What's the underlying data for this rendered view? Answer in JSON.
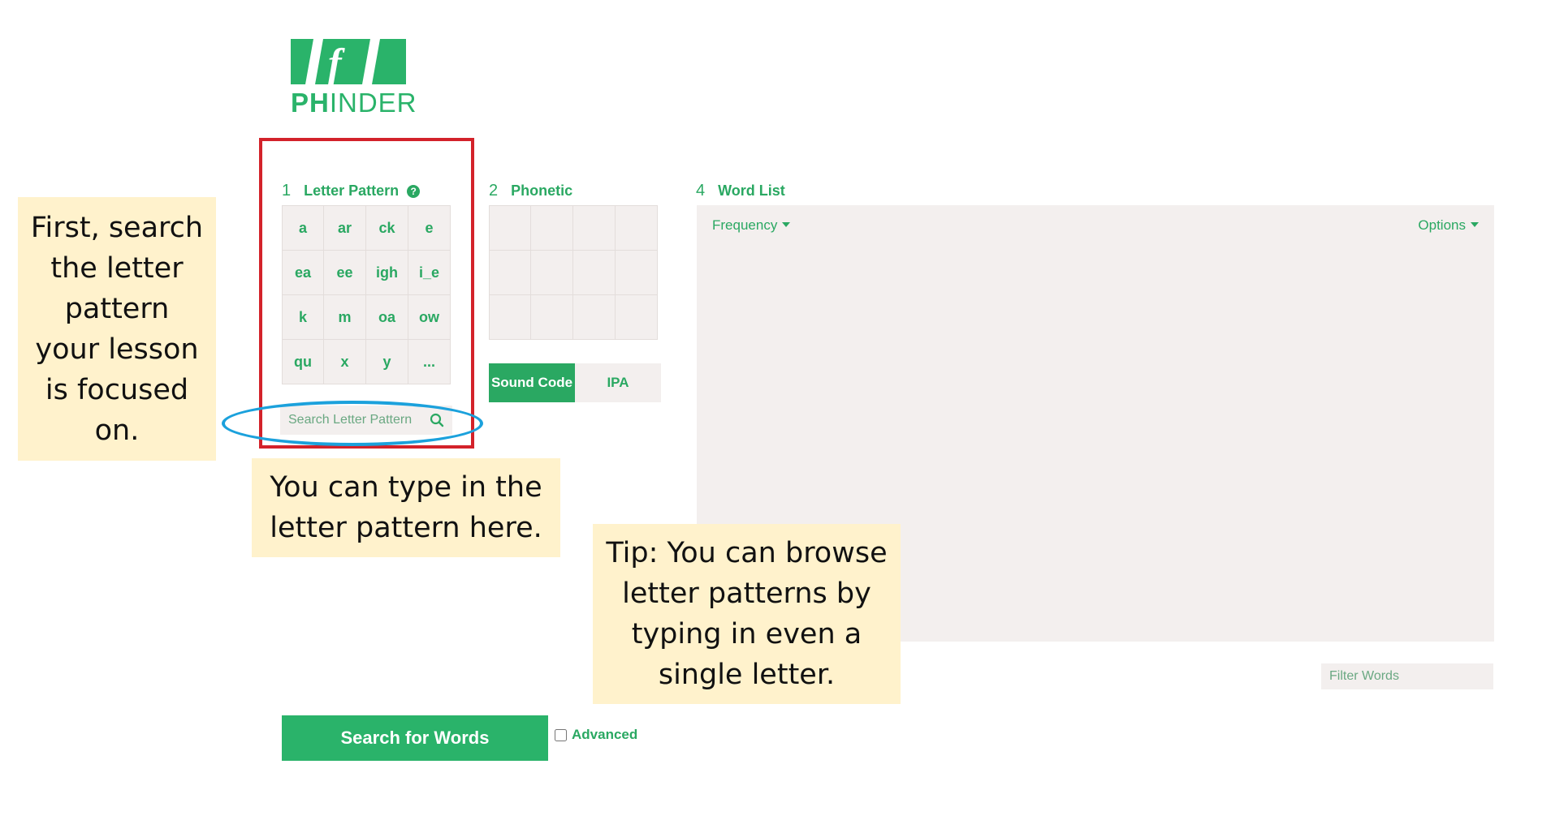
{
  "logo": {
    "text_bold": "PH",
    "text_thin": "INDER"
  },
  "sections": {
    "letter_pattern": {
      "number": "1",
      "title": "Letter Pattern",
      "help": "?"
    },
    "phonetic": {
      "number": "2",
      "title": "Phonetic"
    },
    "word_list": {
      "number": "4",
      "title": "Word List"
    }
  },
  "letter_patterns": [
    "a",
    "ar",
    "ck",
    "e",
    "ea",
    "ee",
    "igh",
    "i_e",
    "k",
    "m",
    "oa",
    "ow",
    "qu",
    "x",
    "y",
    "..."
  ],
  "search_letter_pattern": {
    "placeholder": "Search Letter Pattern"
  },
  "phonetic_toggle": {
    "sound_code": "Sound Code",
    "ipa": "IPA"
  },
  "word_list": {
    "frequency": "Frequency",
    "options": "Options"
  },
  "filter_words": {
    "placeholder": "Filter Words"
  },
  "search_button": "Search for Words",
  "advanced_label": "Advanced",
  "callouts": {
    "first": [
      "First, search",
      "the letter",
      "pattern",
      "your lesson",
      "is focused",
      "on."
    ],
    "type": [
      "You can type in the",
      "letter pattern here."
    ],
    "tip": [
      "Tip: You can browse",
      "letter patterns by",
      "typing in even a",
      "single letter."
    ]
  },
  "colors": {
    "brand_green": "#2aa862",
    "panel_bg": "#f3efee",
    "callout_bg": "#fff2cc",
    "highlight_red": "#d3222a",
    "highlight_blue": "#1ba1dc"
  }
}
